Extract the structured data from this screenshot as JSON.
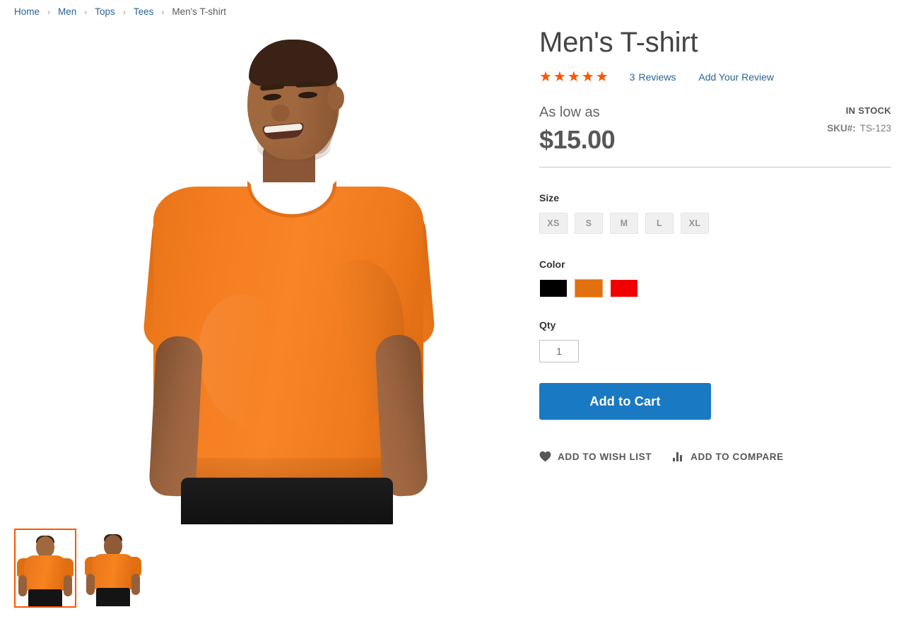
{
  "breadcrumb": {
    "separator": "›",
    "items": [
      {
        "label": "Home",
        "current": false
      },
      {
        "label": "Men",
        "current": false
      },
      {
        "label": "Tops",
        "current": false
      },
      {
        "label": "Tees",
        "current": false
      },
      {
        "label": "Men's T-shirt",
        "current": true
      }
    ]
  },
  "product": {
    "title": "Men's T-shirt",
    "rating": {
      "stars_filled": 5,
      "stars_glyph": "★★★★★",
      "reviews_count": "3",
      "reviews_label": "Reviews",
      "add_review_label": "Add Your Review",
      "star_color": "#ff5501"
    },
    "price": {
      "as_low_as_label": "As low as",
      "value": "$15.00"
    },
    "availability": "IN STOCK",
    "sku_label": "SKU#:",
    "sku_value": "TS-123"
  },
  "options": {
    "size": {
      "label": "Size",
      "values": [
        "XS",
        "S",
        "M",
        "L",
        "XL"
      ]
    },
    "color": {
      "label": "Color",
      "values": [
        {
          "name": "Black",
          "hex": "#000000",
          "selected": false
        },
        {
          "name": "Orange",
          "hex": "#e2700f",
          "selected": true
        },
        {
          "name": "Red",
          "hex": "#f20000",
          "selected": false
        }
      ]
    }
  },
  "qty": {
    "label": "Qty",
    "value": "1"
  },
  "actions": {
    "add_to_cart_label": "Add to Cart",
    "add_to_cart_color": "#1979c3",
    "wishlist_label": "Add to Wish List",
    "compare_label": "Add to Compare"
  },
  "gallery": {
    "main_image_alt": "Man wearing orange t-shirt, front view",
    "thumbnails": [
      {
        "alt": "Front view thumbnail",
        "selected": true
      },
      {
        "alt": "Back view thumbnail",
        "selected": false
      }
    ],
    "selected_border_color": "#ff5501"
  }
}
